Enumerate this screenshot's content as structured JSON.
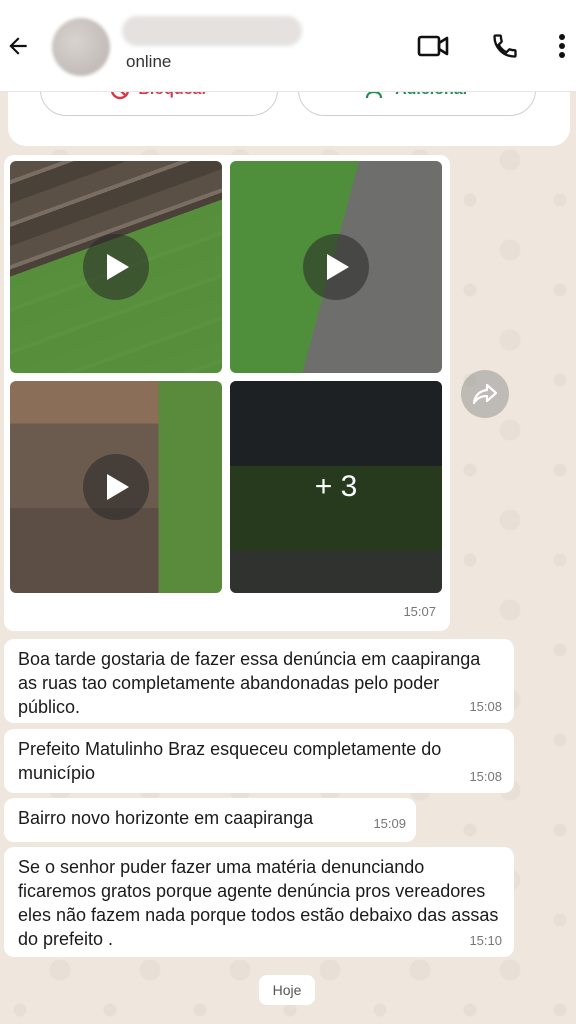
{
  "header": {
    "status": "online"
  },
  "actions": {
    "block_label": "Bloquear",
    "add_label": "Adicionar"
  },
  "media_message": {
    "more_count": "+ 3",
    "time": "15:07"
  },
  "messages": [
    {
      "text": "Boa tarde gostaria de fazer essa denúncia em caapiranga as ruas tao completamente abandonadas pelo poder público.",
      "time": "15:08"
    },
    {
      "text": "Prefeito Matulinho Braz esqueceu completamente do município",
      "time": "15:08"
    },
    {
      "text": "Bairro novo horizonte em caapiranga",
      "time": "15:09"
    },
    {
      "text": "Se o senhor puder fazer uma matéria denunciando ficaremos gratos porque agente denúncia pros vereadores eles não fazem nada porque todos estão debaixo das assas do prefeito .",
      "time": "15:10"
    }
  ],
  "date_divider": "Hoje",
  "colors": {
    "chat_background": "#efe7dd",
    "block_red": "#d6394a",
    "add_green": "#1f8f4e"
  }
}
